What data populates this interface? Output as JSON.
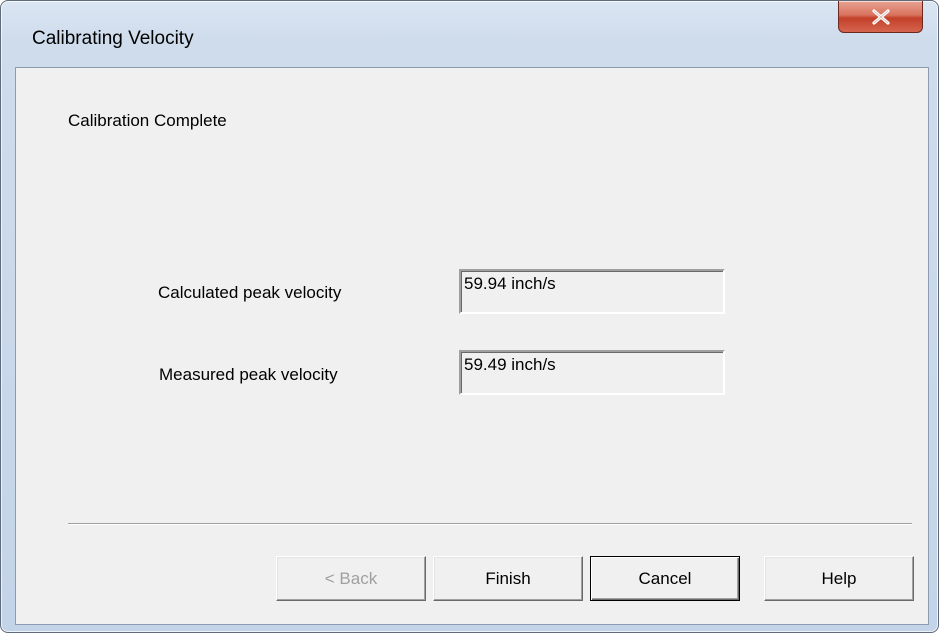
{
  "window": {
    "title": "Calibrating Velocity"
  },
  "content": {
    "heading": "Calibration Complete",
    "fields": [
      {
        "label": "Calculated peak velocity",
        "value": "59.94 inch/s"
      },
      {
        "label": "Measured peak velocity",
        "value": "59.49 inch/s"
      }
    ]
  },
  "buttons": {
    "back": "< Back",
    "finish": "Finish",
    "cancel": "Cancel",
    "help": "Help"
  },
  "icons": {
    "close": "close-icon"
  },
  "colors": {
    "dialog_background": "#f0f0f0",
    "close_button": "#c7432d",
    "disabled_text": "#a0a0a0"
  }
}
